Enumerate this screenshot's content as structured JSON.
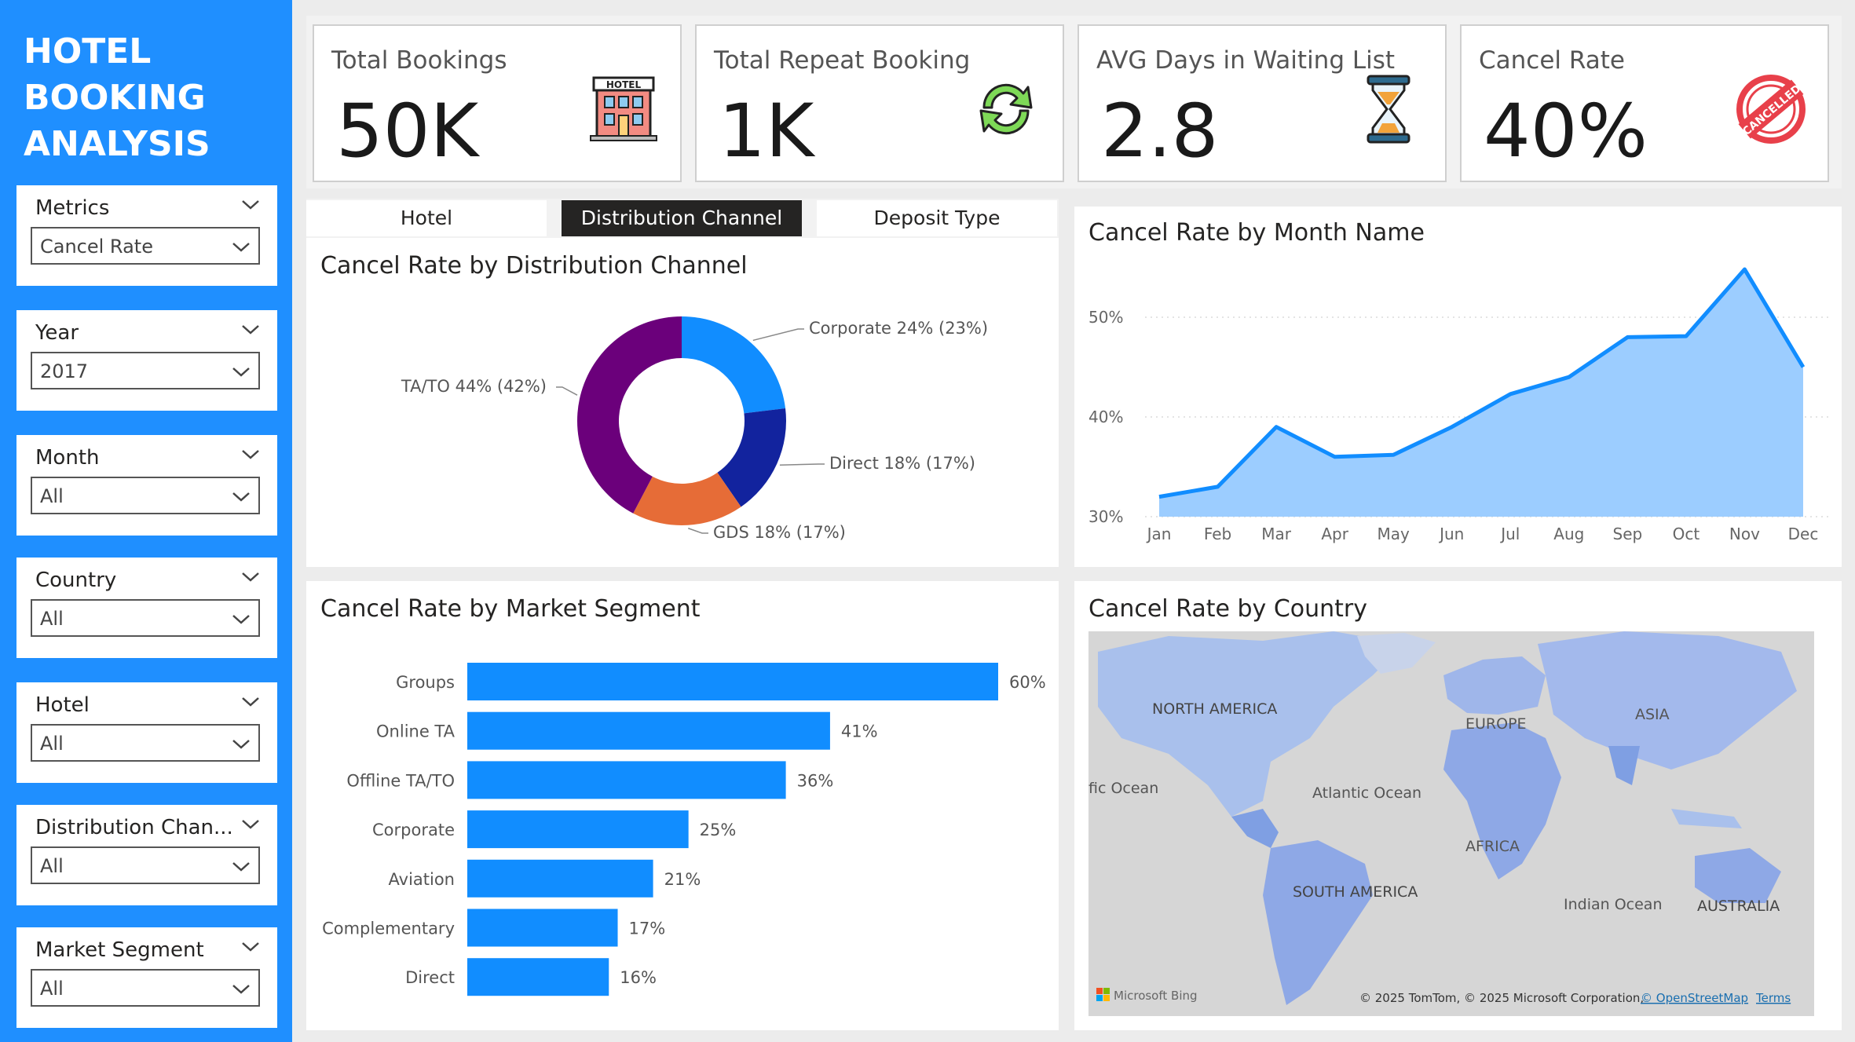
{
  "sidebar": {
    "title": "HOTEL BOOKING ANALYSIS",
    "slicers": [
      {
        "title": "Metrics",
        "value": "Cancel Rate"
      },
      {
        "title": "Year",
        "value": "2017"
      },
      {
        "title": "Month",
        "value": "All"
      },
      {
        "title": "Country",
        "value": "All"
      },
      {
        "title": "Hotel",
        "value": "All"
      },
      {
        "title": "Distribution Chan...",
        "value": "All"
      },
      {
        "title": "Market Segment",
        "value": "All"
      }
    ]
  },
  "kpis": [
    {
      "label": "Total Bookings",
      "value": "50K",
      "icon": "hotel-icon"
    },
    {
      "label": "Total Repeat Booking",
      "value": "1K",
      "icon": "refresh-icon"
    },
    {
      "label": "AVG Days in Waiting List",
      "value": "2.8",
      "icon": "hourglass-icon"
    },
    {
      "label": "Cancel Rate",
      "value": "40%",
      "icon": "cancelled-stamp-icon"
    }
  ],
  "tabs": [
    {
      "label": "Hotel",
      "active": false
    },
    {
      "label": "Distribution Channel",
      "active": true
    },
    {
      "label": "Deposit Type",
      "active": false
    }
  ],
  "donut": {
    "title": "Cancel Rate by Distribution Channel"
  },
  "line_panel": {
    "title": "Cancel Rate by Month Name"
  },
  "bar_panel": {
    "title": "Cancel Rate by Market Segment"
  },
  "map": {
    "title": "Cancel Rate by Country",
    "labels": {
      "north_america": "NORTH AMERICA",
      "europe": "EUROPE",
      "asia": "ASIA",
      "africa": "AFRICA",
      "south_america": "SOUTH AMERICA",
      "australia": "AUSTRALIA",
      "atlantic": "Atlantic Ocean",
      "pacific": "fic Ocean",
      "indian": "Indian Ocean"
    },
    "logo": "Microsoft Bing",
    "attribution": "© 2025 TomTom, © 2025 Microsoft Corporation,",
    "osm": "© OpenStreetMap",
    "terms": "Terms"
  },
  "colors": {
    "accent": "#1f8fff",
    "bar": "#118dff",
    "area": "#9ccdff",
    "corporate": "#118dff",
    "direct": "#12239e",
    "gds": "#e66c37",
    "ta_to": "#6b007b"
  },
  "chart_data": [
    {
      "type": "pie",
      "title": "Cancel Rate by Distribution Channel",
      "slices": [
        {
          "name": "Corporate",
          "value": 24,
          "label": "Corporate 24% (23%)"
        },
        {
          "name": "Direct",
          "value": 18,
          "label": "Direct 18% (17%)"
        },
        {
          "name": "GDS",
          "value": 18,
          "label": "GDS 18% (17%)"
        },
        {
          "name": "TA/TO",
          "value": 44,
          "label": "TA/TO 44% (42%)"
        }
      ]
    },
    {
      "type": "area",
      "title": "Cancel Rate by Month Name",
      "categories": [
        "Jan",
        "Feb",
        "Mar",
        "Apr",
        "May",
        "Jun",
        "Jul",
        "Aug",
        "Sep",
        "Oct",
        "Nov",
        "Dec"
      ],
      "values": [
        32,
        33,
        39,
        36,
        36.2,
        39,
        42.3,
        44,
        48,
        48.1,
        54.8,
        45
      ],
      "y_ticks": [
        "30%",
        "40%",
        "50%"
      ],
      "ylim": [
        30,
        56
      ],
      "grid": true
    },
    {
      "type": "bar",
      "orientation": "horizontal",
      "title": "Cancel Rate by Market Segment",
      "categories": [
        "Groups",
        "Online TA",
        "Offline TA/TO",
        "Corporate",
        "Aviation",
        "Complementary",
        "Direct"
      ],
      "values": [
        60,
        41,
        36,
        25,
        21,
        17,
        16
      ],
      "labels": [
        "60%",
        "41%",
        "36%",
        "25%",
        "21%",
        "17%",
        "16%"
      ]
    }
  ]
}
